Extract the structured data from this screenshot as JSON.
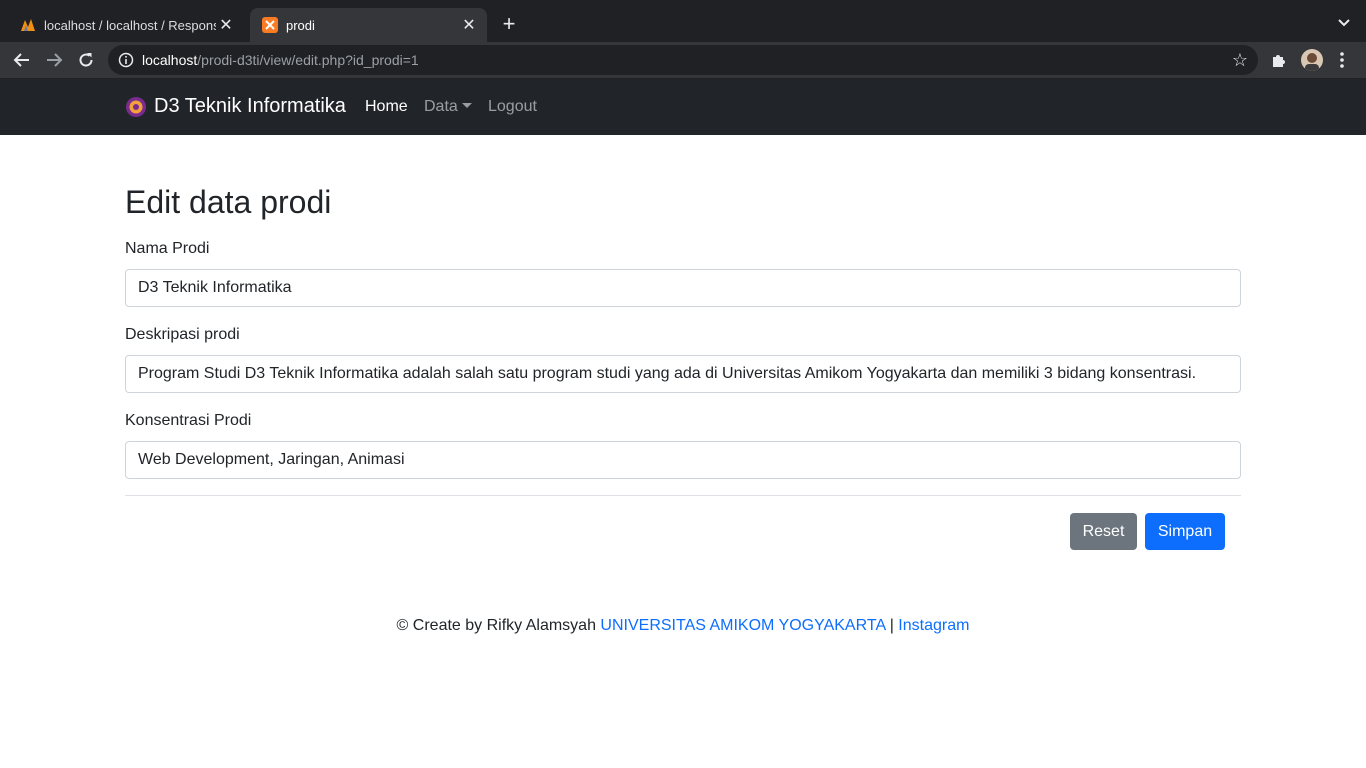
{
  "browser": {
    "tabs": [
      {
        "title": "localhost / localhost / Respons",
        "active": false
      },
      {
        "title": "prodi",
        "active": true
      }
    ],
    "url_host": "localhost",
    "url_path": "/prodi-d3ti/view/edit.php?id_prodi=1"
  },
  "navbar": {
    "brand": "D3 Teknik Informatika",
    "links": {
      "home": "Home",
      "data": "Data",
      "logout": "Logout"
    }
  },
  "form": {
    "title": "Edit data prodi",
    "nama_label": "Nama Prodi",
    "nama_value": "D3 Teknik Informatika",
    "deskripsi_label": "Deskripasi prodi",
    "deskripsi_value": "Program Studi D3 Teknik Informatika adalah salah satu program studi yang ada di Universitas Amikom Yogyakarta dan memiliki 3 bidang konsentrasi.",
    "konsentrasi_label": "Konsentrasi Prodi",
    "konsentrasi_value": "Web Development, Jaringan, Animasi",
    "reset_label": "Reset",
    "save_label": "Simpan"
  },
  "footer": {
    "prefix": "© Create by Rifky Alamsyah",
    "university_link": "UNIVERSITAS AMIKOM YOGYAKARTA",
    "separator": "|",
    "instagram_link": "Instagram"
  },
  "colors": {
    "navbar_bg": "#212529",
    "primary": "#0d6efd",
    "secondary": "#6c757d"
  }
}
